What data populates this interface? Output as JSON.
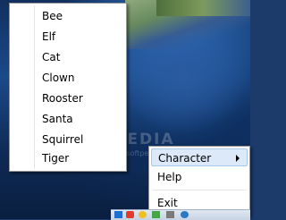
{
  "submenu": {
    "items": [
      "Bee",
      "Elf",
      "Cat",
      "Clown",
      "Rooster",
      "Santa",
      "Squirrel",
      "Tiger"
    ]
  },
  "main_menu": {
    "character": "Character",
    "help": "Help",
    "exit": "Exit"
  },
  "watermark": {
    "text": "SOFTPEDIA",
    "url": "www.softpedia.com"
  },
  "colors": {
    "menu_bg": "#ffffff",
    "highlight_bg": "#dbe9f8",
    "highlight_border": "#a6c6ec"
  }
}
